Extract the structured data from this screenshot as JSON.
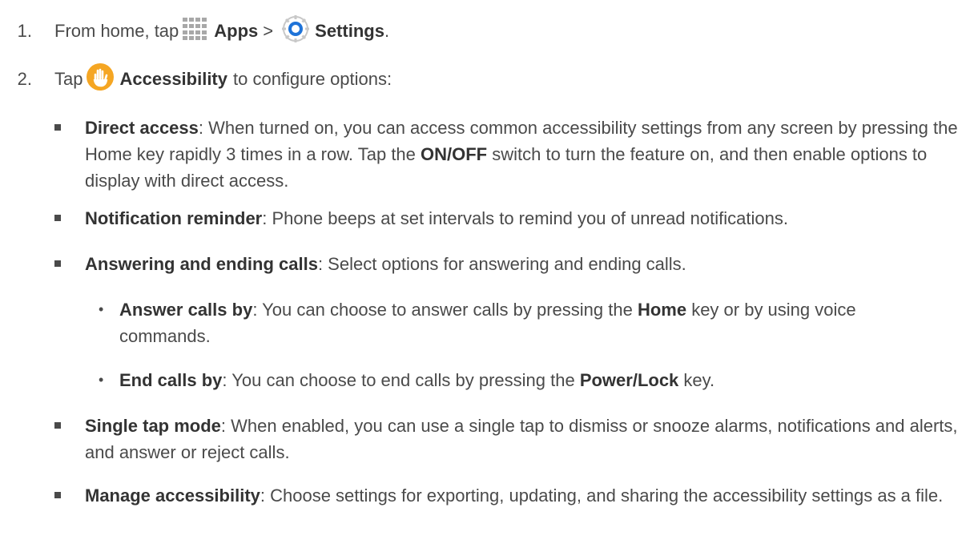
{
  "steps": [
    {
      "number": "1.",
      "pre": "From home, tap",
      "app": "Apps",
      "sep": ">",
      "setting": "Settings",
      "end": "."
    },
    {
      "number": "2.",
      "pre": "Tap",
      "target": "Accessibility",
      "post": "to configure options:"
    }
  ],
  "options": [
    {
      "title": "Direct access",
      "parts": [
        ": When turned on, you can access common accessibility settings from any screen by pressing the Home key rapidly 3 times in a row. Tap the ",
        "ON/OFF",
        " switch to turn the feature on, and then enable options to display with direct access."
      ]
    },
    {
      "title": "Notification reminder",
      "parts": [
        ": Phone beeps at set intervals to remind you of unread notifications."
      ]
    },
    {
      "title": "Answering and ending calls",
      "parts": [
        ": Select options for answering and ending calls."
      ]
    },
    {
      "title": "Single tap mode",
      "parts": [
        ": When enabled, you can use a single tap to dismiss or snooze alarms, notifications and alerts, and answer or reject calls."
      ]
    },
    {
      "title": "Manage accessibility",
      "parts": [
        ": Choose settings for exporting, updating, and sharing the accessibility settings as a file."
      ]
    }
  ],
  "suboptions": [
    {
      "title": "Answer calls by",
      "parts": [
        ": You can choose to answer calls by pressing the ",
        "Home",
        " key or by using voice commands."
      ]
    },
    {
      "title": "End calls by",
      "parts": [
        ": You can choose to end calls by pressing the ",
        "Power/Lock",
        " key."
      ]
    }
  ],
  "icons": {
    "apps": "apps-grid-icon",
    "settings": "settings-gear-icon",
    "accessibility": "accessibility-hand-icon"
  },
  "colors": {
    "text": "#4a4a4a",
    "apps_icon": "#a8a8a8",
    "settings_icon": "#1e73d8",
    "accessibility_icon": "#f5a623"
  }
}
